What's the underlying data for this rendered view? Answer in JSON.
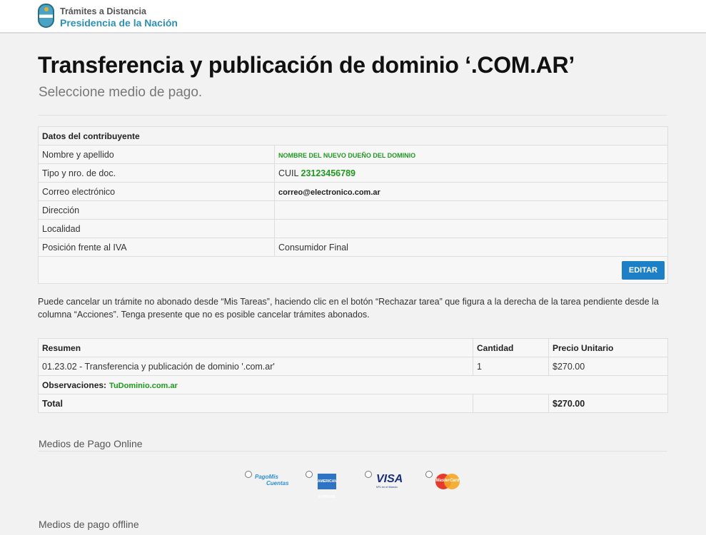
{
  "header": {
    "brand_line1": "Trámites a Distancia",
    "brand_line2": "Presidencia de la Nación"
  },
  "page": {
    "title": "Transferencia y publicación de dominio ‘.COM.AR’",
    "subtitle": "Seleccione medio de pago."
  },
  "contribuyente": {
    "heading": "Datos del contribuyente",
    "rows": [
      {
        "label": "Nombre y apellido",
        "value": "NOMBRE DEL NUEVO DUEÑO DEL DOMINIO"
      },
      {
        "label": "Tipo y nro. de doc.",
        "prefix": "CUIL",
        "value": "23123456789"
      },
      {
        "label": "Correo electrónico",
        "value": "correo@electronico.com.ar"
      },
      {
        "label": "Dirección",
        "value": ""
      },
      {
        "label": "Localidad",
        "value": ""
      },
      {
        "label": "Posición frente al IVA",
        "value": "Consumidor Final"
      }
    ],
    "edit_label": "EDITAR"
  },
  "note": "Puede cancelar un trámite no abonado desde “Mis Tareas”, haciendo clic en el botón “Rechazar tarea” que figura a la derecha de la tarea pendiente desde la columna “Acciones”. Tenga presente que no es posible cancelar trámites abonados.",
  "resumen": {
    "headers": [
      "Resumen",
      "Cantidad",
      "Precio Unitario"
    ],
    "item": {
      "desc": "01.23.02 - Transferencia y publicación de dominio '.com.ar'",
      "qty": "1",
      "price": "$270.00"
    },
    "obs_label": "Observaciones:",
    "obs_value": "TuDominio.com.ar",
    "total_label": "Total",
    "total_value": "$270.00"
  },
  "payment": {
    "online_label": "Medios de Pago Online",
    "offline_label": "Medios de pago offline",
    "methods": [
      {
        "name": "PagoMisCuentas",
        "line1": "PagoMis",
        "line2": "Cuentas"
      },
      {
        "name": "American Express",
        "text": "AMERICAN EXPRESS"
      },
      {
        "name": "Visa",
        "text": "VISA",
        "sub": "Nº1 en el Mundo"
      },
      {
        "name": "MasterCard",
        "text": "MasterCard"
      }
    ]
  },
  "colors": {
    "accent": "#1d7fc6",
    "brand": "#2d8fb8",
    "highlight_green": "#1f9a1f"
  }
}
